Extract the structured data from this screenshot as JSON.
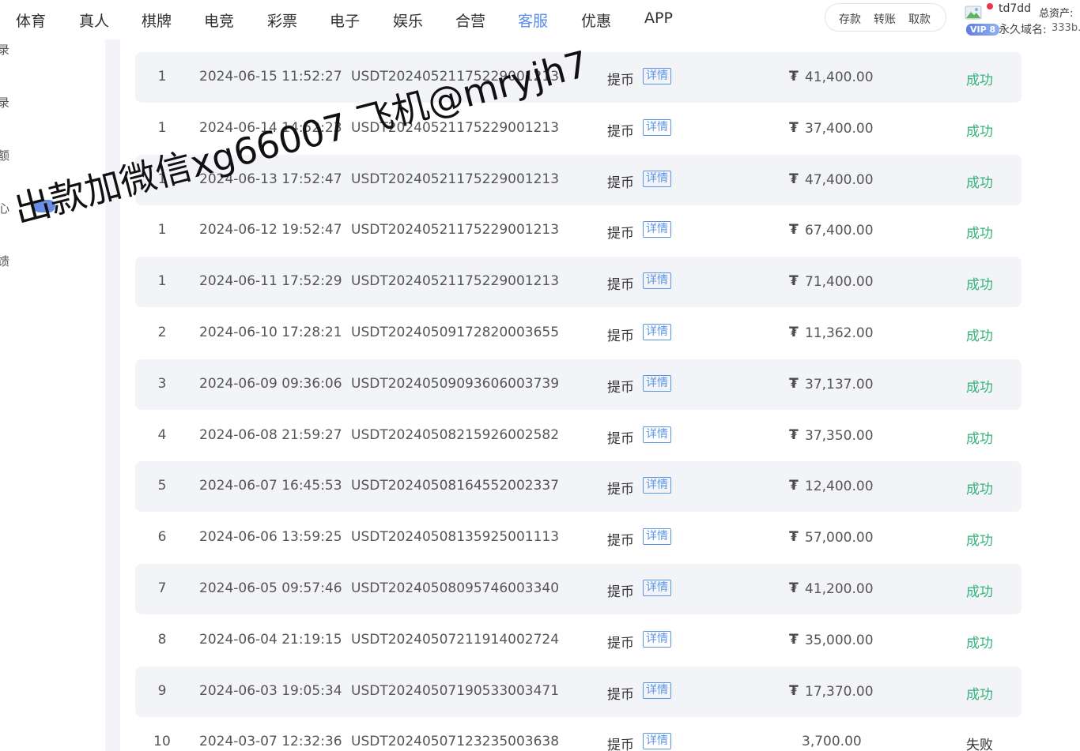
{
  "nav": {
    "items": [
      "体育",
      "真人",
      "棋牌",
      "电竞",
      "彩票",
      "电子",
      "娱乐",
      "合营",
      "客服",
      "优惠",
      "APP"
    ],
    "active_index": 8,
    "active_color": "#5b8ee6"
  },
  "funds": {
    "deposit": "存款",
    "transfer": "转账",
    "withdraw": "取款"
  },
  "user": {
    "name": "td7dd",
    "asset_label": "总资产:",
    "vip_label": "VIP 8",
    "domain_label": "永久域名:",
    "domain_value": "333b."
  },
  "sidebar": {
    "items": [
      "录",
      "录",
      "额",
      "心",
      "馈"
    ]
  },
  "records": [
    {
      "index": "1",
      "time": "2024-06-15 11:52:27",
      "order": "USDT20240521175229001213",
      "type": "提币",
      "detail": "详情",
      "amount": "41,400.00",
      "currency_icon": "tether-icon",
      "status": "成功"
    },
    {
      "index": "1",
      "time": "2024-06-14 14:52:23",
      "order": "USDT20240521175229001213",
      "type": "提币",
      "detail": "详情",
      "amount": "37,400.00",
      "currency_icon": "tether-icon",
      "status": "成功"
    },
    {
      "index": "1",
      "time": "2024-06-13 17:52:47",
      "order": "USDT20240521175229001213",
      "type": "提币",
      "detail": "详情",
      "amount": "47,400.00",
      "currency_icon": "tether-icon",
      "status": "成功"
    },
    {
      "index": "1",
      "time": "2024-06-12 19:52:47",
      "order": "USDT20240521175229001213",
      "type": "提币",
      "detail": "详情",
      "amount": "67,400.00",
      "currency_icon": "tether-icon",
      "status": "成功"
    },
    {
      "index": "1",
      "time": "2024-06-11 17:52:29",
      "order": "USDT20240521175229001213",
      "type": "提币",
      "detail": "详情",
      "amount": "71,400.00",
      "currency_icon": "tether-icon",
      "status": "成功"
    },
    {
      "index": "2",
      "time": "2024-06-10 17:28:21",
      "order": "USDT20240509172820003655",
      "type": "提币",
      "detail": "详情",
      "amount": "11,362.00",
      "currency_icon": "tether-icon",
      "status": "成功"
    },
    {
      "index": "3",
      "time": "2024-06-09 09:36:06",
      "order": "USDT20240509093606003739",
      "type": "提币",
      "detail": "详情",
      "amount": "37,137.00",
      "currency_icon": "tether-icon",
      "status": "成功"
    },
    {
      "index": "4",
      "time": "2024-06-08 21:59:27",
      "order": "USDT20240508215926002582",
      "type": "提币",
      "detail": "详情",
      "amount": "37,350.00",
      "currency_icon": "tether-icon",
      "status": "成功"
    },
    {
      "index": "5",
      "time": "2024-06-07 16:45:53",
      "order": "USDT20240508164552002337",
      "type": "提币",
      "detail": "详情",
      "amount": "12,400.00",
      "currency_icon": "tether-icon",
      "status": "成功"
    },
    {
      "index": "6",
      "time": "2024-06-06 13:59:25",
      "order": "USDT20240508135925001113",
      "type": "提币",
      "detail": "详情",
      "amount": "57,000.00",
      "currency_icon": "tether-icon",
      "status": "成功"
    },
    {
      "index": "7",
      "time": "2024-06-05 09:57:46",
      "order": "USDT20240508095746003340",
      "type": "提币",
      "detail": "详情",
      "amount": "41,200.00",
      "currency_icon": "tether-icon",
      "status": "成功"
    },
    {
      "index": "8",
      "time": "2024-06-04 21:19:15",
      "order": "USDT20240507211914002724",
      "type": "提币",
      "detail": "详情",
      "amount": "35,000.00",
      "currency_icon": "tether-icon",
      "status": "成功"
    },
    {
      "index": "9",
      "time": "2024-06-03 19:05:34",
      "order": "USDT20240507190533003471",
      "type": "提币",
      "detail": "详情",
      "amount": "17,370.00",
      "currency_icon": "tether-icon",
      "status": "成功"
    },
    {
      "index": "10",
      "time": "2024-03-07 12:32:36",
      "order": "USDT20240507123235003638",
      "type": "提币",
      "detail": "详情",
      "amount": "3,700.00",
      "currency_icon": "",
      "status": "失败"
    }
  ],
  "status_colors": {
    "success": "#33b27a",
    "fail": "#333333"
  },
  "watermark": "出款加微信xg66007 飞机@mryjh7"
}
